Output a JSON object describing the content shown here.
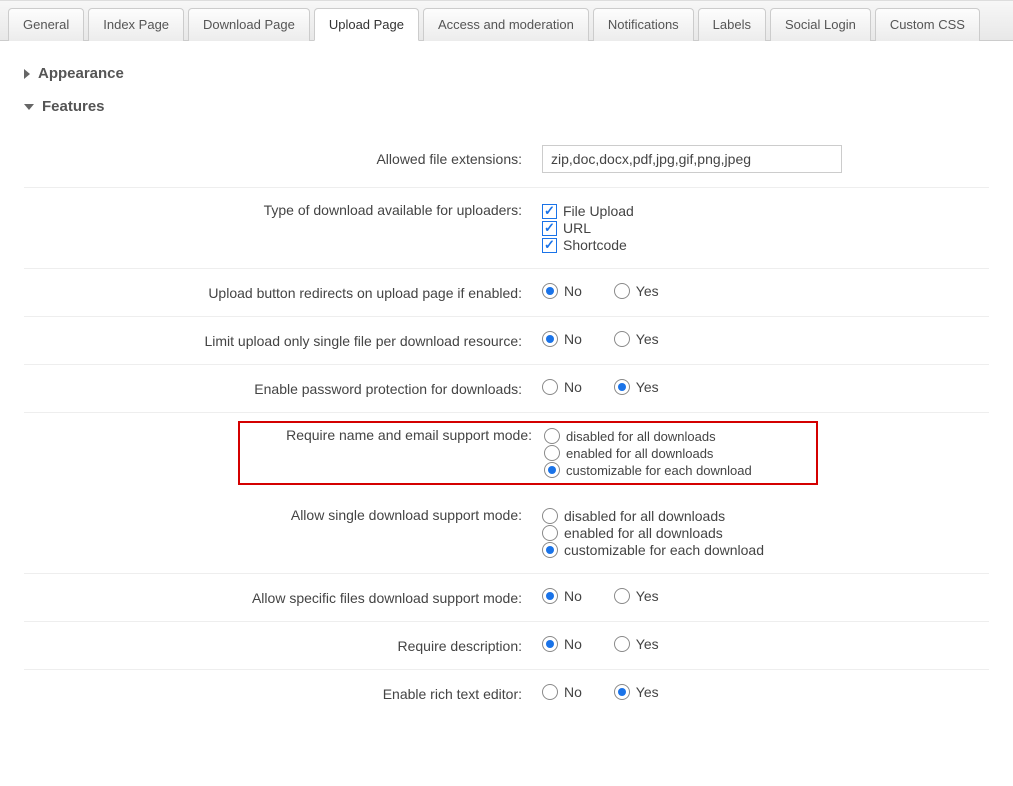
{
  "tabs": [
    {
      "label": "General"
    },
    {
      "label": "Index Page"
    },
    {
      "label": "Download Page"
    },
    {
      "label": "Upload Page",
      "active": true
    },
    {
      "label": "Access and moderation"
    },
    {
      "label": "Notifications"
    },
    {
      "label": "Labels"
    },
    {
      "label": "Social Login"
    },
    {
      "label": "Custom CSS"
    }
  ],
  "sections": {
    "appearance": {
      "title": "Appearance",
      "expanded": false
    },
    "features": {
      "title": "Features",
      "expanded": true
    }
  },
  "fields": {
    "allowed_ext": {
      "label": "Allowed file extensions:",
      "value": "zip,doc,docx,pdf,jpg,gif,png,jpeg"
    },
    "download_types": {
      "label": "Type of download available for uploaders:",
      "options": [
        {
          "label": "File Upload",
          "checked": true
        },
        {
          "label": "URL",
          "checked": true
        },
        {
          "label": "Shortcode",
          "checked": true
        }
      ]
    },
    "upload_redirect": {
      "label": "Upload button redirects on upload page if enabled:",
      "no": "No",
      "yes": "Yes",
      "value": "no"
    },
    "single_file": {
      "label": "Limit upload only single file per download resource:",
      "no": "No",
      "yes": "Yes",
      "value": "no"
    },
    "password_protect": {
      "label": "Enable password protection for downloads:",
      "no": "No",
      "yes": "Yes",
      "value": "yes"
    },
    "require_name_email": {
      "label": "Require name and email support mode:",
      "options": [
        {
          "label": "disabled for all downloads",
          "checked": false
        },
        {
          "label": "enabled for all downloads",
          "checked": false
        },
        {
          "label": "customizable for each download",
          "checked": true
        }
      ]
    },
    "single_download": {
      "label": "Allow single download support mode:",
      "options": [
        {
          "label": "disabled for all downloads",
          "checked": false
        },
        {
          "label": "enabled for all downloads",
          "checked": false
        },
        {
          "label": "customizable for each download",
          "checked": true
        }
      ]
    },
    "specific_files": {
      "label": "Allow specific files download support mode:",
      "no": "No",
      "yes": "Yes",
      "value": "no"
    },
    "require_description": {
      "label": "Require description:",
      "no": "No",
      "yes": "Yes",
      "value": "no"
    },
    "rich_editor": {
      "label": "Enable rich text editor:",
      "no": "No",
      "yes": "Yes",
      "value": "yes"
    }
  }
}
